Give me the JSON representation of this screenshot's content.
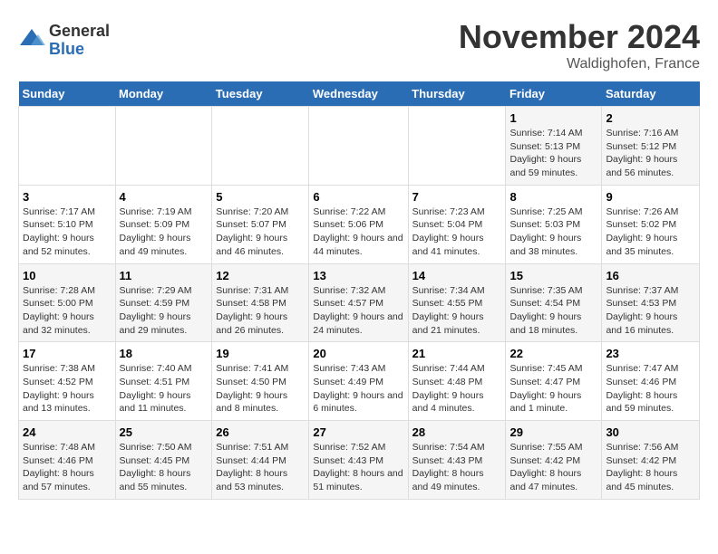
{
  "header": {
    "logo_general": "General",
    "logo_blue": "Blue",
    "month_title": "November 2024",
    "location": "Waldighofen, France"
  },
  "columns": [
    "Sunday",
    "Monday",
    "Tuesday",
    "Wednesday",
    "Thursday",
    "Friday",
    "Saturday"
  ],
  "weeks": [
    [
      {
        "day": "",
        "info": ""
      },
      {
        "day": "",
        "info": ""
      },
      {
        "day": "",
        "info": ""
      },
      {
        "day": "",
        "info": ""
      },
      {
        "day": "",
        "info": ""
      },
      {
        "day": "1",
        "info": "Sunrise: 7:14 AM\nSunset: 5:13 PM\nDaylight: 9 hours and 59 minutes."
      },
      {
        "day": "2",
        "info": "Sunrise: 7:16 AM\nSunset: 5:12 PM\nDaylight: 9 hours and 56 minutes."
      }
    ],
    [
      {
        "day": "3",
        "info": "Sunrise: 7:17 AM\nSunset: 5:10 PM\nDaylight: 9 hours and 52 minutes."
      },
      {
        "day": "4",
        "info": "Sunrise: 7:19 AM\nSunset: 5:09 PM\nDaylight: 9 hours and 49 minutes."
      },
      {
        "day": "5",
        "info": "Sunrise: 7:20 AM\nSunset: 5:07 PM\nDaylight: 9 hours and 46 minutes."
      },
      {
        "day": "6",
        "info": "Sunrise: 7:22 AM\nSunset: 5:06 PM\nDaylight: 9 hours and 44 minutes."
      },
      {
        "day": "7",
        "info": "Sunrise: 7:23 AM\nSunset: 5:04 PM\nDaylight: 9 hours and 41 minutes."
      },
      {
        "day": "8",
        "info": "Sunrise: 7:25 AM\nSunset: 5:03 PM\nDaylight: 9 hours and 38 minutes."
      },
      {
        "day": "9",
        "info": "Sunrise: 7:26 AM\nSunset: 5:02 PM\nDaylight: 9 hours and 35 minutes."
      }
    ],
    [
      {
        "day": "10",
        "info": "Sunrise: 7:28 AM\nSunset: 5:00 PM\nDaylight: 9 hours and 32 minutes."
      },
      {
        "day": "11",
        "info": "Sunrise: 7:29 AM\nSunset: 4:59 PM\nDaylight: 9 hours and 29 minutes."
      },
      {
        "day": "12",
        "info": "Sunrise: 7:31 AM\nSunset: 4:58 PM\nDaylight: 9 hours and 26 minutes."
      },
      {
        "day": "13",
        "info": "Sunrise: 7:32 AM\nSunset: 4:57 PM\nDaylight: 9 hours and 24 minutes."
      },
      {
        "day": "14",
        "info": "Sunrise: 7:34 AM\nSunset: 4:55 PM\nDaylight: 9 hours and 21 minutes."
      },
      {
        "day": "15",
        "info": "Sunrise: 7:35 AM\nSunset: 4:54 PM\nDaylight: 9 hours and 18 minutes."
      },
      {
        "day": "16",
        "info": "Sunrise: 7:37 AM\nSunset: 4:53 PM\nDaylight: 9 hours and 16 minutes."
      }
    ],
    [
      {
        "day": "17",
        "info": "Sunrise: 7:38 AM\nSunset: 4:52 PM\nDaylight: 9 hours and 13 minutes."
      },
      {
        "day": "18",
        "info": "Sunrise: 7:40 AM\nSunset: 4:51 PM\nDaylight: 9 hours and 11 minutes."
      },
      {
        "day": "19",
        "info": "Sunrise: 7:41 AM\nSunset: 4:50 PM\nDaylight: 9 hours and 8 minutes."
      },
      {
        "day": "20",
        "info": "Sunrise: 7:43 AM\nSunset: 4:49 PM\nDaylight: 9 hours and 6 minutes."
      },
      {
        "day": "21",
        "info": "Sunrise: 7:44 AM\nSunset: 4:48 PM\nDaylight: 9 hours and 4 minutes."
      },
      {
        "day": "22",
        "info": "Sunrise: 7:45 AM\nSunset: 4:47 PM\nDaylight: 9 hours and 1 minute."
      },
      {
        "day": "23",
        "info": "Sunrise: 7:47 AM\nSunset: 4:46 PM\nDaylight: 8 hours and 59 minutes."
      }
    ],
    [
      {
        "day": "24",
        "info": "Sunrise: 7:48 AM\nSunset: 4:46 PM\nDaylight: 8 hours and 57 minutes."
      },
      {
        "day": "25",
        "info": "Sunrise: 7:50 AM\nSunset: 4:45 PM\nDaylight: 8 hours and 55 minutes."
      },
      {
        "day": "26",
        "info": "Sunrise: 7:51 AM\nSunset: 4:44 PM\nDaylight: 8 hours and 53 minutes."
      },
      {
        "day": "27",
        "info": "Sunrise: 7:52 AM\nSunset: 4:43 PM\nDaylight: 8 hours and 51 minutes."
      },
      {
        "day": "28",
        "info": "Sunrise: 7:54 AM\nSunset: 4:43 PM\nDaylight: 8 hours and 49 minutes."
      },
      {
        "day": "29",
        "info": "Sunrise: 7:55 AM\nSunset: 4:42 PM\nDaylight: 8 hours and 47 minutes."
      },
      {
        "day": "30",
        "info": "Sunrise: 7:56 AM\nSunset: 4:42 PM\nDaylight: 8 hours and 45 minutes."
      }
    ]
  ]
}
